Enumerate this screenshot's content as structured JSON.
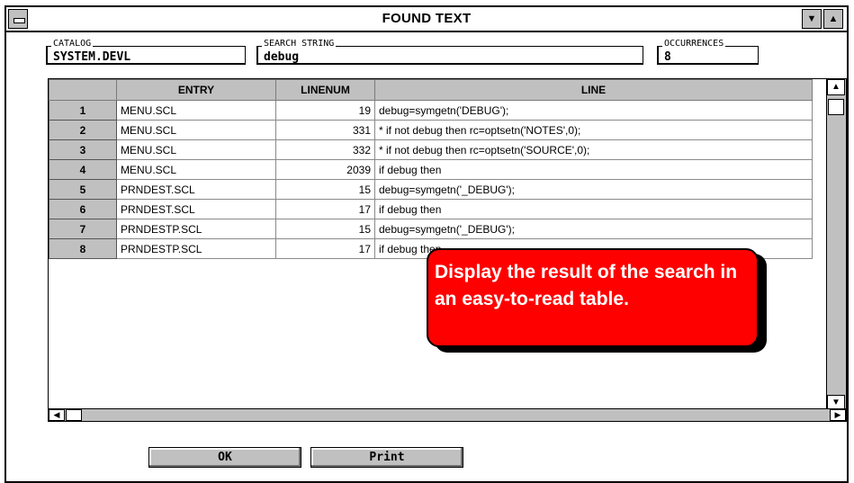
{
  "window": {
    "title": "FOUND TEXT"
  },
  "fields": {
    "catalog": {
      "label": "CATALOG",
      "value": "SYSTEM.DEVL"
    },
    "search_string": {
      "label": "SEARCH STRING",
      "value": "debug"
    },
    "occurrences": {
      "label": "OCCURRENCES",
      "value": "8"
    }
  },
  "table": {
    "columns": [
      "ENTRY",
      "LINENUM",
      "LINE"
    ],
    "rows": [
      {
        "num": "1",
        "entry": "MENU.SCL",
        "linenum": "19",
        "line": "debug=symgetn('DEBUG');"
      },
      {
        "num": "2",
        "entry": "MENU.SCL",
        "linenum": "331",
        "line": "* if not debug then rc=optsetn('NOTES',0);"
      },
      {
        "num": "3",
        "entry": "MENU.SCL",
        "linenum": "332",
        "line": "* if not debug then rc=optsetn('SOURCE',0);"
      },
      {
        "num": "4",
        "entry": "MENU.SCL",
        "linenum": "2039",
        "line": "if debug then"
      },
      {
        "num": "5",
        "entry": "PRNDEST.SCL",
        "linenum": "15",
        "line": "debug=symgetn('_DEBUG');"
      },
      {
        "num": "6",
        "entry": "PRNDEST.SCL",
        "linenum": "17",
        "line": "if debug then"
      },
      {
        "num": "7",
        "entry": "PRNDESTP.SCL",
        "linenum": "15",
        "line": "debug=symgetn('_DEBUG');"
      },
      {
        "num": "8",
        "entry": "PRNDESTP.SCL",
        "linenum": "17",
        "line": "if debug then"
      }
    ]
  },
  "buttons": {
    "ok": "OK",
    "print": "Print"
  },
  "callout": {
    "text": "Display the result of the search in an easy-to-read table."
  },
  "icons": {
    "system_menu": "system-menu-icon",
    "minimize": "minimize-arrow-icon",
    "maximize": "maximize-arrow-icon",
    "scroll_up": "scroll-up-arrow-icon",
    "scroll_down": "scroll-down-arrow-icon",
    "scroll_left": "scroll-left-arrow-icon",
    "scroll_right": "scroll-right-arrow-icon"
  },
  "colors": {
    "callout_bg": "#ff0000",
    "chrome_gray": "#c0c0c0"
  }
}
